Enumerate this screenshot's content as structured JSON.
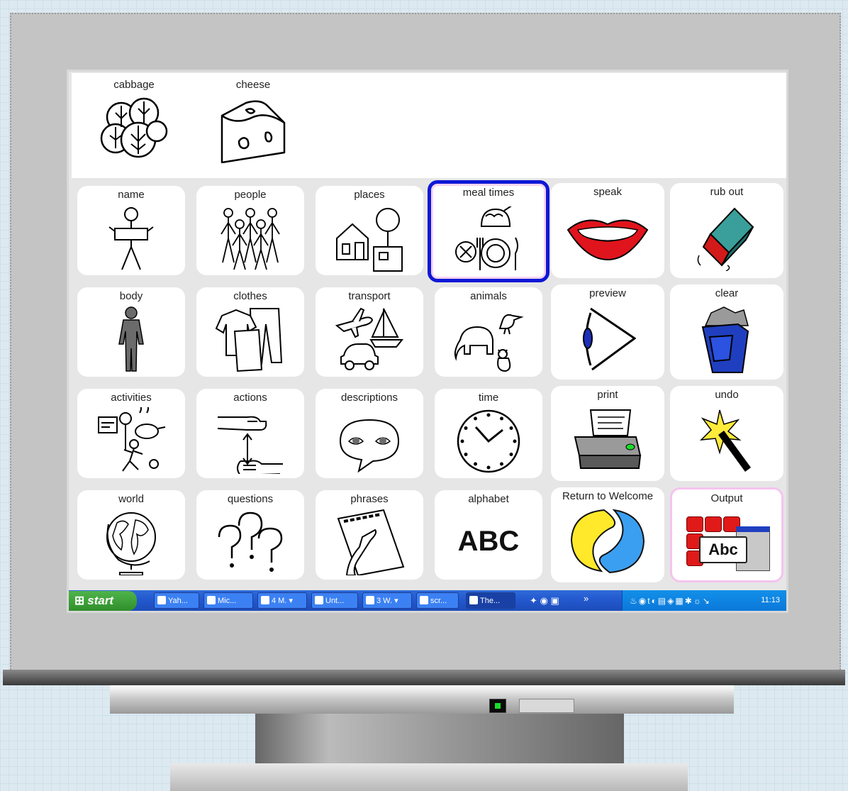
{
  "message_bar": {
    "items": [
      {
        "label": "cabbage",
        "icon": "cabbage-icon"
      },
      {
        "label": "cheese",
        "icon": "cheese-icon"
      }
    ]
  },
  "grid": {
    "cells": [
      {
        "label": "name",
        "icon": "name-icon"
      },
      {
        "label": "people",
        "icon": "people-icon"
      },
      {
        "label": "places",
        "icon": "places-icon"
      },
      {
        "label": "meal times",
        "icon": "meal-times-icon",
        "selected": true
      },
      {
        "label": "speak",
        "icon": "speak-icon"
      },
      {
        "label": "rub out",
        "icon": "rub-out-icon"
      },
      {
        "label": "body",
        "icon": "body-icon"
      },
      {
        "label": "clothes",
        "icon": "clothes-icon"
      },
      {
        "label": "transport",
        "icon": "transport-icon"
      },
      {
        "label": "animals",
        "icon": "animals-icon"
      },
      {
        "label": "preview",
        "icon": "preview-icon"
      },
      {
        "label": "clear",
        "icon": "clear-icon"
      },
      {
        "label": "activities",
        "icon": "activities-icon"
      },
      {
        "label": "actions",
        "icon": "actions-icon"
      },
      {
        "label": "descriptions",
        "icon": "descriptions-icon"
      },
      {
        "label": "time",
        "icon": "clock-icon"
      },
      {
        "label": "print",
        "icon": "printer-icon"
      },
      {
        "label": "undo",
        "icon": "undo-icon"
      },
      {
        "label": "world",
        "icon": "globe-icon"
      },
      {
        "label": "questions",
        "icon": "questions-icon"
      },
      {
        "label": "phrases",
        "icon": "phrases-icon"
      },
      {
        "label": "alphabet",
        "icon": "alphabet-icon",
        "icon_text": "ABC"
      },
      {
        "label": "Return to Welcome",
        "icon": "welcome-logo-icon"
      },
      {
        "label": "Output",
        "icon": "output-icon",
        "icon_text": "Abc"
      }
    ]
  },
  "taskbar": {
    "start_label": "start",
    "buttons": [
      {
        "label": "Yah..."
      },
      {
        "label": "Mic..."
      },
      {
        "label": "4 M."
      },
      {
        "label": "Unt..."
      },
      {
        "label": "3 W."
      },
      {
        "label": "scr..."
      },
      {
        "label": "The...",
        "active": true
      }
    ],
    "chevron": "»",
    "clock": "11:13"
  },
  "colors": {
    "selected_border": "#0d18d6",
    "output_border": "#f4c4ee",
    "taskbar_blue": "#245ad0",
    "start_green": "#3a9f36"
  }
}
